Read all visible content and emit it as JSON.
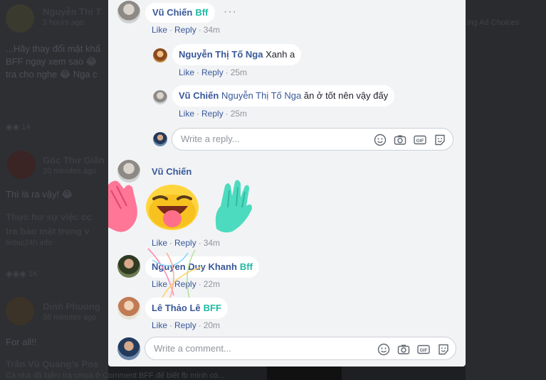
{
  "background_feed": {
    "post1_author": "Nguyễn Thị T",
    "post1_time": "3 hours ago",
    "post1_line1": "...Hãy thay đổi mật khẩ",
    "post1_line2": "BFF ngay xem sao 😂",
    "post1_line3": "tra cho nghe 😂 Nga c",
    "post1_reactions": "14",
    "right_header": "ing   Ad Choices",
    "post2_author": "Góc Thư Giãn",
    "post2_time": "20 minutes ago",
    "post2_line1": "Thì là ra vậy! 😂",
    "post2_line2": "Thực hư sự việc cc",
    "post2_line3": "tra bảo mật trong v",
    "post2_source": "tintuc24h.info",
    "post2_reactions": "1K",
    "post3_author": "Dinh Phuong",
    "post3_time": "36 minutes ago",
    "post3_line1": "For all!!",
    "post3_line2": "Trần Vũ Quang's Pos",
    "post3_line3": "Cả nhà đã kiểm tra cmua ở Comment BFF để biết fb mình có..."
  },
  "comments": [
    {
      "author": "Vũ Chiến",
      "badge": "Bff",
      "actions": {
        "like": "Like",
        "reply": "Reply",
        "time": "34m"
      },
      "more_icon": "···",
      "replies": [
        {
          "author": "Nguyễn Thị Tố Nga",
          "text": "Xanh a",
          "actions": {
            "like": "Like",
            "reply": "Reply",
            "time": "25m"
          }
        },
        {
          "author": "Vũ Chiến",
          "mention": "Nguyễn Thị Tố Nga",
          "text": "ăn ở tốt nên vậy đấy",
          "actions": {
            "like": "Like",
            "reply": "Reply",
            "time": "25m"
          }
        }
      ],
      "reply_box": {
        "placeholder": "Write a reply..."
      }
    },
    {
      "author": "Vũ Chiến",
      "attachment": "sticker-laughing-emoji-waving-hands",
      "actions": {
        "like": "Like",
        "reply": "Reply",
        "time": "34m"
      }
    },
    {
      "author": "Nguyen Duy Khanh",
      "badge": "Bff",
      "actions": {
        "like": "Like",
        "reply": "Reply",
        "time": "22m"
      }
    },
    {
      "author": "Lê Thảo Lê",
      "badge": "BFF",
      "actions": {
        "like": "Like",
        "reply": "Reply",
        "time": "20m"
      }
    }
  ],
  "comment_box": {
    "placeholder": "Write a comment..."
  },
  "icons": [
    "emoji-icon",
    "camera-icon",
    "gif-icon",
    "sticker-icon"
  ],
  "colors": {
    "link": "#385898",
    "bff": "#1fb9a3",
    "muted": "#90949c",
    "panel_bg": "#f2f3f5"
  }
}
